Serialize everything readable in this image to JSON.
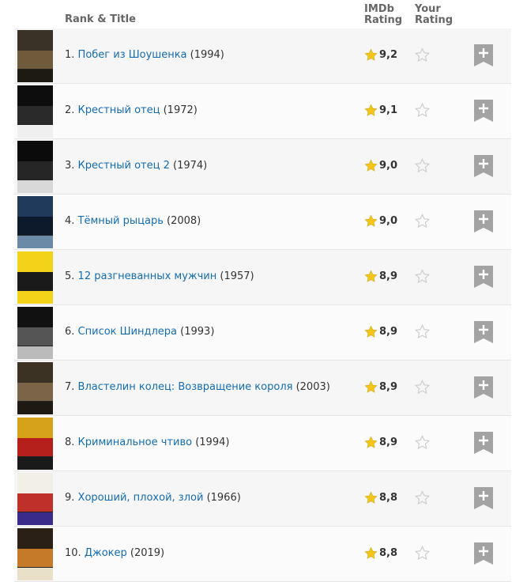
{
  "header": {
    "rank_title": "Rank & Title",
    "imdb_line1": "IMDb",
    "imdb_line2": "Rating",
    "your_line1": "Your",
    "your_line2": "Rating"
  },
  "colors": {
    "link": "#136cb2",
    "star_gold": "#f5c518",
    "star_empty": "#cccccc",
    "add_button": "#a3a3a3"
  },
  "movies": [
    {
      "rank": "1.",
      "title": "Побег из Шоушенка",
      "year": "(1994)",
      "rating": "9,2",
      "poster_colors": [
        "#3a3226",
        "#6f5a3c",
        "#1d1a14"
      ]
    },
    {
      "rank": "2.",
      "title": "Крестный отец",
      "year": "(1972)",
      "rating": "9,1",
      "poster_colors": [
        "#0d0d0d",
        "#2a2a2a",
        "#efefef"
      ]
    },
    {
      "rank": "3.",
      "title": "Крестный отец 2",
      "year": "(1974)",
      "rating": "9,0",
      "poster_colors": [
        "#0b0b0b",
        "#262626",
        "#d8d8d8"
      ]
    },
    {
      "rank": "4.",
      "title": "Тёмный рыцарь",
      "year": "(2008)",
      "rating": "9,0",
      "poster_colors": [
        "#1f3a5a",
        "#0d1a2b",
        "#6b8aa8"
      ]
    },
    {
      "rank": "5.",
      "title": "12 разгневанных мужчин",
      "year": "(1957)",
      "rating": "8,9",
      "poster_colors": [
        "#f3d21a",
        "#1a1a1a",
        "#f3d21a"
      ]
    },
    {
      "rank": "6.",
      "title": "Список Шиндлера",
      "year": "(1993)",
      "rating": "8,9",
      "poster_colors": [
        "#111111",
        "#555555",
        "#bbbbbb"
      ]
    },
    {
      "rank": "7.",
      "title": "Властелин колец: Возвращение короля",
      "year": "(2003)",
      "rating": "8,9",
      "poster_colors": [
        "#3b3224",
        "#7a6548",
        "#1e1a13"
      ]
    },
    {
      "rank": "8.",
      "title": "Криминальное чтиво",
      "year": "(1994)",
      "rating": "8,9",
      "poster_colors": [
        "#d6a21a",
        "#b5201c",
        "#1a1a1a"
      ]
    },
    {
      "rank": "9.",
      "title": "Хороший, плохой, злой",
      "year": "(1966)",
      "rating": "8,8",
      "poster_colors": [
        "#f2efe6",
        "#c0302a",
        "#3a2a8a"
      ]
    },
    {
      "rank": "10.",
      "title": "Джокер",
      "year": "(2019)",
      "rating": "8,8",
      "poster_colors": [
        "#2b2016",
        "#c57a2a",
        "#e8e0c8"
      ]
    }
  ]
}
